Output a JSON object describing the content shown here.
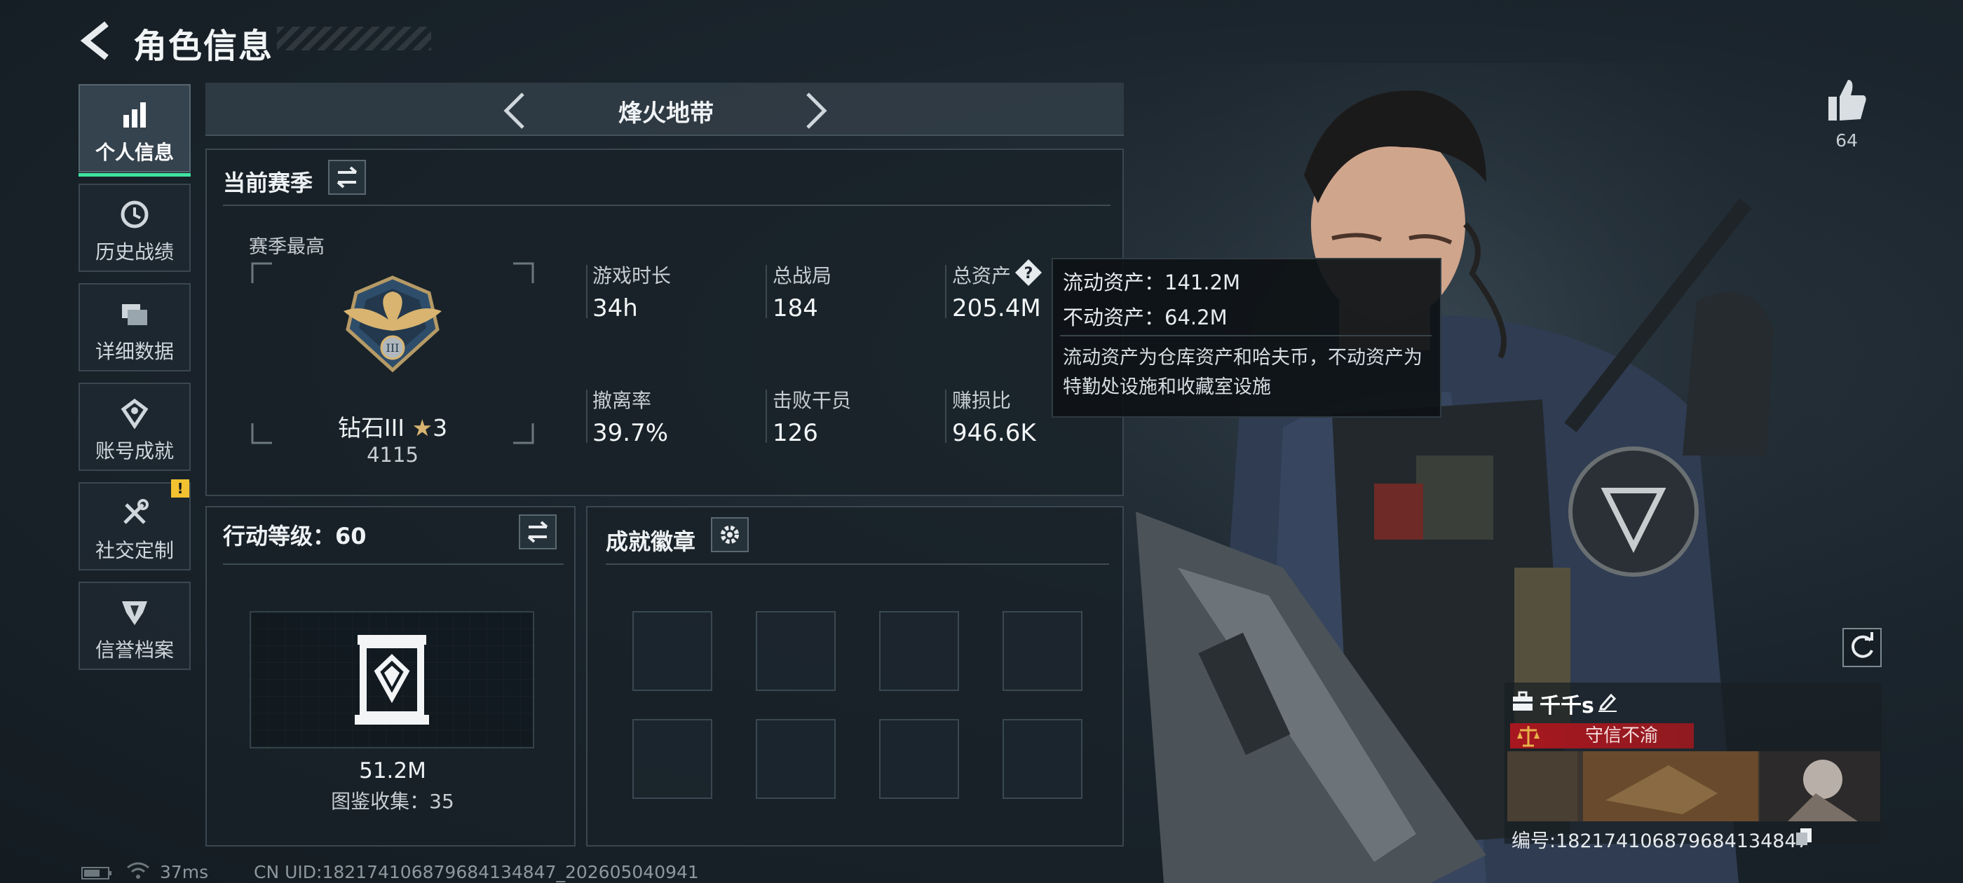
{
  "header": {
    "title": "角色信息"
  },
  "sidebar": {
    "items": [
      {
        "label": "个人信息",
        "icon": "bar-chart-icon",
        "active": true
      },
      {
        "label": "历史战绩",
        "icon": "history-clock-icon"
      },
      {
        "label": "详细数据",
        "icon": "folders-icon"
      },
      {
        "label": "账号成就",
        "icon": "achievement-icon"
      },
      {
        "label": "社交定制",
        "icon": "tools-icon",
        "badge": "!"
      },
      {
        "label": "信誉档案",
        "icon": "reputation-shield-icon"
      }
    ]
  },
  "mode": {
    "title": "烽火地带"
  },
  "season": {
    "title": "当前赛季",
    "best_label": "赛季最高",
    "rank_name": "钻石III",
    "rank_stars": "3",
    "rank_score": "4115",
    "stats": [
      {
        "label": "游戏时长",
        "value": "34h"
      },
      {
        "label": "总战局",
        "value": "184"
      },
      {
        "label": "总资产",
        "value": "205.4M"
      },
      {
        "label": "撤离率",
        "value": "39.7%"
      },
      {
        "label": "击败干员",
        "value": "126"
      },
      {
        "label": "赚损比",
        "value": "946.6K"
      }
    ]
  },
  "tooltip": {
    "liquid": "流动资产：141.2M",
    "fixed": "不动资产：64.2M",
    "desc": "流动资产为仓库资产和哈夫币，不动资产为特勤处设施和收藏室设施"
  },
  "level": {
    "title": "行动等级：60",
    "value": "51.2M",
    "collect": "图鉴收集：35"
  },
  "badges": {
    "title": "成就徽章",
    "slot_count": 8
  },
  "status": {
    "ping": "37ms",
    "uid": "CN UID:1821741068796841348​47_202605040941"
  },
  "like": {
    "count": "64"
  },
  "player": {
    "name": "千千s",
    "title": "守信不渝",
    "id": "编号:1821741068796841348​47"
  },
  "colors": {
    "accent": "#3ee3a0",
    "warning": "#f2c230",
    "title_banner": "#a8171f"
  }
}
